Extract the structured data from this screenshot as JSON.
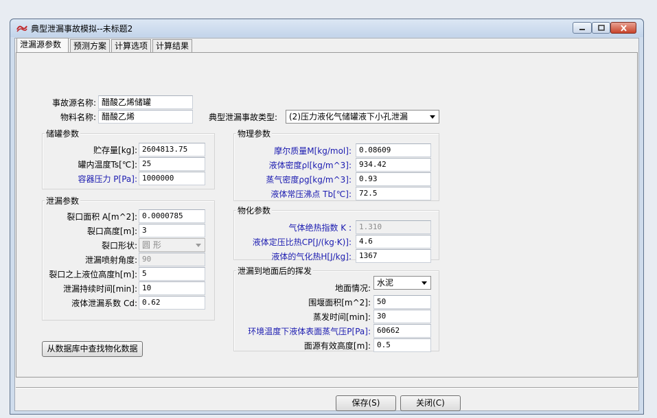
{
  "window": {
    "title": "典型泄漏事故模拟--未标题2"
  },
  "tabs": [
    "泄漏源参数",
    "预测方案",
    "计算选项",
    "计算结果"
  ],
  "source": {
    "name_label": "事故源名称:",
    "name_value": "醋酸乙烯储罐",
    "material_label": "物料名称:",
    "material_value": "醋酸乙烯",
    "type_label": "典型泄漏事故类型:",
    "type_value": "(2)压力液化气储罐液下小孔泄漏"
  },
  "storage": {
    "title": "储罐参数",
    "mass_label": "贮存量[kg]:",
    "mass_value": "2604813.75",
    "temp_label": "罐内温度Ts[℃]:",
    "temp_value": "25",
    "pressure_label": "容器压力 P[Pa]:",
    "pressure_value": "1000000"
  },
  "leak": {
    "title": "泄漏参数",
    "area_label": "裂口面积 A[m^2]:",
    "area_value": "0.0000785",
    "height_label": "裂口高度[m]:",
    "height_value": "3",
    "shape_label": "裂口形状:",
    "shape_value": "圆  形",
    "angle_label": "泄漏喷射角度:",
    "angle_value": "90",
    "level_label": "裂口之上液位高度h[m]:",
    "level_value": "5",
    "duration_label": "泄漏持续时间[min]:",
    "duration_value": "10",
    "cd_label": "液体泄漏系数  Cd:",
    "cd_value": "0.62"
  },
  "physical": {
    "title": "物理参数",
    "molar_label": "摩尔质量M[kg/mol]:",
    "molar_value": "0.08609",
    "liquid_density_label": "液体密度ρl[kg/m^3]:",
    "liquid_density_value": "934.42",
    "vapor_density_label": "蒸气密度ρg[kg/m^3]:",
    "vapor_density_value": "0.93",
    "boiling_label": "液体常压沸点 Tb[℃]:",
    "boiling_value": "72.5"
  },
  "chemical": {
    "title": "物化参数",
    "k_label": "气体绝热指数  K :",
    "k_value": "1.310",
    "cp_label": "液体定压比热CP[J/(kg·K)]:",
    "cp_value": "4.6",
    "heat_label": "液体的气化热H[J/kg]:",
    "heat_value": "1367"
  },
  "evaporation": {
    "title": "泄漏到地面后的挥发",
    "ground_label": "地面情况:",
    "ground_value": "水泥",
    "weir_label": "围堰面积[m^2]:",
    "weir_value": "50",
    "evap_time_label": "蒸发时间[min]:",
    "evap_time_value": "30",
    "vapor_pressure_label": "环境温度下液体表面蒸气压P[Pa]:",
    "vapor_pressure_value": "60662",
    "surface_height_label": "面源有效高度[m]:",
    "surface_height_value": "0.5"
  },
  "buttons": {
    "lookup": "从数据库中查找物化数据",
    "save": "保存(S)",
    "close": "关闭(C)"
  },
  "colors": {
    "blue_label": "#1b1bb0",
    "close_red": "#c9442b"
  }
}
